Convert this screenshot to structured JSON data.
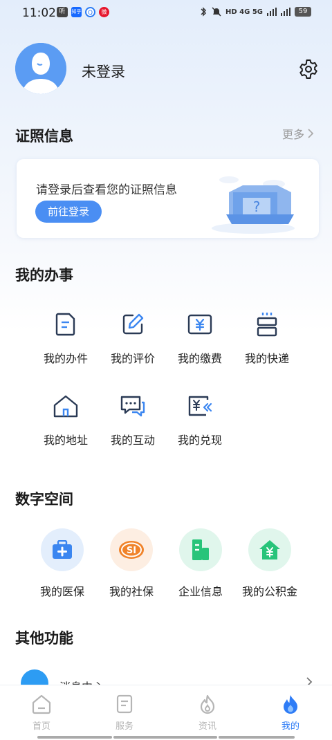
{
  "status_bar": {
    "time": "11:02",
    "left_icons": [
      "听",
      "知乎",
      "Q",
      "微"
    ],
    "right_text": "HD 4G 5G",
    "battery": "59"
  },
  "profile": {
    "name": "未登录",
    "avatar_icon": "avatar-icon",
    "settings_icon": "gear-icon"
  },
  "license": {
    "title": "证照信息",
    "more": "更多",
    "prompt": "请登录后查看您的证照信息",
    "login_button": "前往登录"
  },
  "affairs": {
    "title": "我的办事",
    "items": [
      {
        "label": "我的办件",
        "icon": "document-icon"
      },
      {
        "label": "我的评价",
        "icon": "edit-icon"
      },
      {
        "label": "我的缴费",
        "icon": "yuan-card-icon"
      },
      {
        "label": "我的快递",
        "icon": "package-icon"
      },
      {
        "label": "我的地址",
        "icon": "house-icon"
      },
      {
        "label": "我的互动",
        "icon": "chat-icon"
      },
      {
        "label": "我的兑现",
        "icon": "cash-back-icon"
      }
    ]
  },
  "digital_space": {
    "title": "数字空间",
    "items": [
      {
        "label": "我的医保",
        "icon": "medical-kit-icon",
        "color": "#3b86f0",
        "bg": "#e3eefc"
      },
      {
        "label": "我的社保",
        "icon": "social-security-icon",
        "color": "#f0832a",
        "bg": "#fdeee2"
      },
      {
        "label": "企业信息",
        "icon": "building-icon",
        "color": "#28c47a",
        "bg": "#e0f6ec"
      },
      {
        "label": "我的公积金",
        "icon": "housing-fund-icon",
        "color": "#28c47a",
        "bg": "#e0f6ec"
      }
    ]
  },
  "other": {
    "title": "其他功能",
    "message_center": "消息中心"
  },
  "tabbar": {
    "tabs": [
      {
        "label": "首页",
        "icon": "home-icon",
        "active": false
      },
      {
        "label": "服务",
        "icon": "service-icon",
        "active": false
      },
      {
        "label": "资讯",
        "icon": "flame-outline-icon",
        "active": false
      },
      {
        "label": "我的",
        "icon": "flame-icon",
        "active": true
      }
    ]
  },
  "colors": {
    "accent": "#2e7cf6",
    "icon_dark": "#2a3a55",
    "icon_blue": "#3b86f0"
  }
}
